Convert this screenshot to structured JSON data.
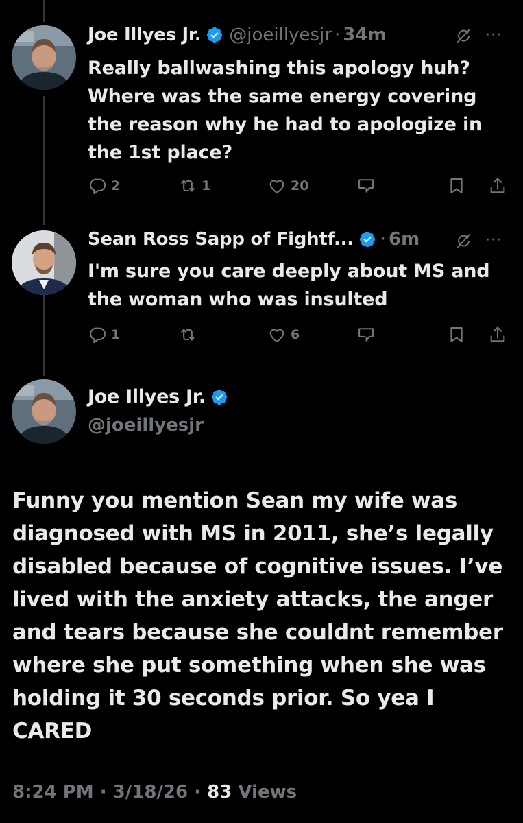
{
  "reply1": {
    "name": "Joe Illyes Jr.",
    "handle": "@joeillyesjr",
    "sep": "·",
    "time": "34m",
    "text": "Really ballwashing this apology huh? Where was the same energy covering the reason why he had to apologize in the 1st place?",
    "replies": "2",
    "reposts": "1",
    "likes": "20"
  },
  "reply2": {
    "name": "Sean Ross Sapp of Fightf...",
    "sep": "·",
    "time": "6m",
    "text": "I'm sure you care deeply about MS and the woman who was insulted",
    "replies": "1",
    "reposts": "",
    "likes": "6"
  },
  "main_tweet": {
    "name": "Joe Illyes Jr.",
    "handle": "@joeillyesjr",
    "text": "Funny you mention Sean my wife was diagnosed with MS in 2011, she’s legally disabled because of cognitive issues. I’ve lived with the anxiety attacks, the anger and tears because she couldnt remember where she put something when she was holding it 30 seconds prior. So yea I CARED",
    "time": "8:24 PM",
    "sep1": "·",
    "date": "3/18/26",
    "sep2": "·",
    "views_count": "83",
    "views_label": "Views"
  },
  "more_label": "···",
  "colors": {
    "background": "#000000",
    "text": "#e7e9ea",
    "muted": "#71767b",
    "verified": "#1d9bf0",
    "thread_line": "#333639"
  }
}
